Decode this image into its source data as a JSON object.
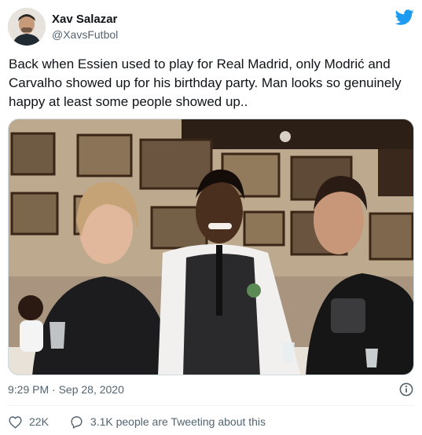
{
  "author": {
    "name": "Xav Salazar",
    "handle": "@XavsFutbol"
  },
  "tweet": {
    "text": "Back when Essien used to play for Real Madrid, only Modrić and Carvalho showed up for his birthday party. Man looks so genuinely happy at least some people showed up..",
    "timestamp": "9:29 PM · Sep 28, 2020"
  },
  "actions": {
    "likes": "22K",
    "conversation": "3.1K people are Tweeting about this"
  },
  "icons": {
    "brand": "twitter-bird-icon",
    "info": "info-icon",
    "like": "heart-icon",
    "reply": "speech-bubble-icon"
  },
  "colors": {
    "brand": "#1d9bf0",
    "secondary_text": "#536471",
    "primary_text": "#0f1419"
  }
}
